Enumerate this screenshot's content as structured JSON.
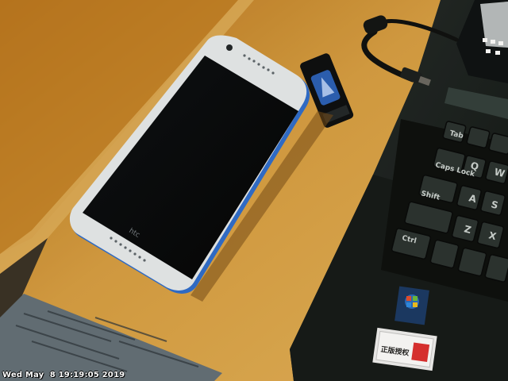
{
  "overlay": {
    "timestamp": "Wed May  8 19:19:05 2019"
  },
  "scene": {
    "phone_brand": "htc",
    "keyboard_keys": [
      "Caps Lock",
      "Shift",
      "Ctrl",
      "Tab",
      "Q",
      "A",
      "Z",
      "W",
      "S",
      "X"
    ],
    "sticker_text": "正版授权"
  },
  "colors": {
    "desk": "#c98a2c",
    "phone_bezel": "#e9edf0",
    "phone_screen": "#05070a",
    "laptop": "#1a1f1d"
  }
}
